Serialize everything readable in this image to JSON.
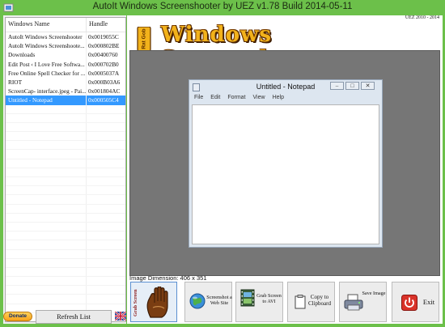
{
  "window": {
    "title": "AutoIt Windows Screenshooter by UEZ v1.78 Build 2014-05-11"
  },
  "list": {
    "headers": {
      "name": "Windows Name",
      "handle": "Handle"
    },
    "rows": [
      {
        "name": "AutoIt Windows Screenshooter",
        "handle": "0x0019055C"
      },
      {
        "name": "AutoIt Windows Screenshoote...",
        "handle": "0x000802BE"
      },
      {
        "name": "Downloads",
        "handle": "0x00400760"
      },
      {
        "name": "Edit Post ‹ I Love Free Softwa...",
        "handle": "0x000702B0"
      },
      {
        "name": "Free Online Spell Checker for ...",
        "handle": "0x0005037A"
      },
      {
        "name": "RIOT",
        "handle": "0x000B03A6"
      },
      {
        "name": "ScreenCap- interface.jpeg - Pai...",
        "handle": "0x001804AC"
      },
      {
        "name": "Untitled - Notepad",
        "handle": "0x000505C4",
        "selected": true
      }
    ]
  },
  "bottom_left": {
    "donate": "Donate",
    "refresh": "Refresh List",
    "flag": "uk-flag-icon"
  },
  "header": {
    "version": "UEZ 2010 - 2014",
    "logo_text": "Windows Screenshooter",
    "logo_side": "Rat Gob"
  },
  "preview": {
    "notepad_title": "Untitled - Notepad",
    "menu": [
      "File",
      "Edit",
      "Format",
      "View",
      "Help"
    ]
  },
  "dimension": {
    "label": "Image Dimension:",
    "value": "406 x 351"
  },
  "toolbar": {
    "grab": "Grab Screen",
    "website": "Screenshot a Web Site",
    "avi": "Grab Screen to AVI",
    "clipboard": "Copy to Clipboard",
    "save": "Save Image",
    "exit": "Exit"
  },
  "colors": {
    "frame": "#6cc04a",
    "preview_bg": "#767676",
    "selection": "#3399ff"
  }
}
